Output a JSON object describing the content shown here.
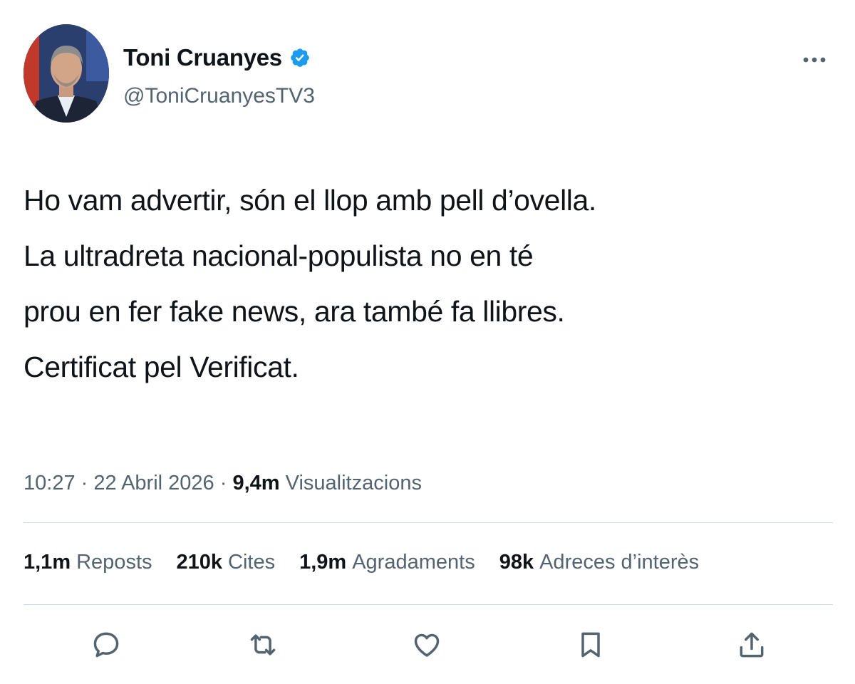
{
  "author": {
    "display_name": "Toni Cruanyes",
    "handle": "@ToniCruanyesTV3",
    "verified_color": "#1d9bf0"
  },
  "tweet": {
    "lines": [
      "Ho vam advertir, són el llop amb pell d’ovella.",
      "La ultradreta nacional-populista no en té",
      "prou en fer fake news, ara també fa llibres.",
      "Certificat pel Verificat."
    ]
  },
  "meta": {
    "time": "10:27",
    "separator": "·",
    "date": "22 Abril 2026",
    "views_count": "9,4m",
    "views_label": "Visualitzacions"
  },
  "stats": {
    "reposts_count": "1,1m",
    "reposts_label": "Reposts",
    "quotes_count": "210k",
    "quotes_label": "Cites",
    "likes_count": "1,9m",
    "likes_label": "Agradaments",
    "bookmarks_count": "98k",
    "bookmarks_label": "Adreces d’interès"
  },
  "icons": {
    "more": "more-horizontal-icon",
    "reply": "reply-icon",
    "retweet": "retweet-icon",
    "like": "heart-icon",
    "bookmark": "bookmark-icon",
    "share": "share-icon"
  },
  "colors": {
    "text": "#0f1419",
    "secondary": "#536471",
    "divider": "#cfd9de",
    "verified": "#1d9bf0"
  }
}
